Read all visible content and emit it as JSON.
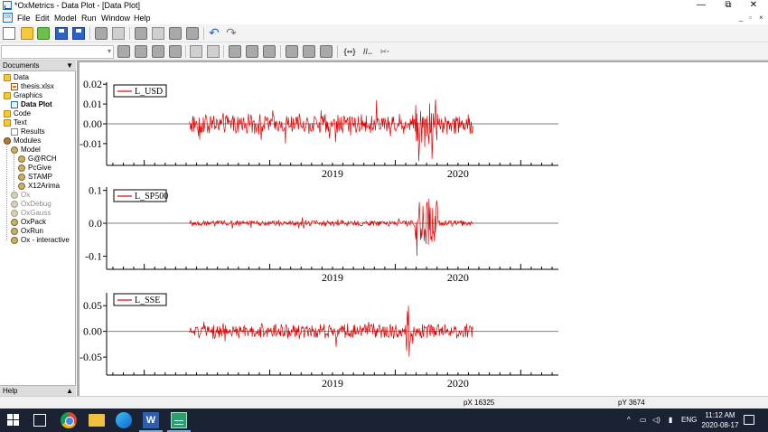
{
  "window": {
    "title": "*OxMetrics - Data Plot - [Data Plot]",
    "minimize_glyph": "—",
    "maximize_glyph": "⧉",
    "close_glyph": "✕"
  },
  "menu": {
    "items": [
      "File",
      "Edit",
      "Model",
      "Run",
      "Window",
      "Help"
    ],
    "mdi_controls": [
      "_",
      "▫",
      "×"
    ]
  },
  "toolbar": {
    "icons": [
      "new-document-icon",
      "open-folder-icon",
      "open-database-icon",
      "save-icon",
      "save-all-icon",
      "print-icon",
      "print-preview-icon",
      "cut-icon",
      "copy-icon",
      "paste-icon",
      "clipboard-icon",
      "undo-icon",
      "redo-icon"
    ],
    "icons_row2": [
      "zoom-in-icon",
      "zoom-out-icon",
      "pointer-icon",
      "rectangle-icon",
      "export-icon",
      "import-icon",
      "search-icon",
      "refresh-icon",
      "chart-icon",
      "arrow-icon",
      "curve-icon",
      "curve-alt-icon",
      "bracket-icon",
      "double-slash-icon",
      "scissors-dots-icon"
    ],
    "row2_texts": [
      "{••}",
      "//..",
      "✂·"
    ]
  },
  "sidebar": {
    "documents_header": "Documents",
    "help_header": "Help",
    "collapse_glyph": "▼",
    "expand_glyph": "▲",
    "tree": [
      {
        "label": "Data",
        "level": 0,
        "icon": "folder",
        "style": "normal"
      },
      {
        "label": "thesis.xlsx",
        "level": 1,
        "icon": "xlsx",
        "style": "normal"
      },
      {
        "label": "Graphics",
        "level": 0,
        "icon": "folder",
        "style": "normal"
      },
      {
        "label": "Data Plot",
        "level": 1,
        "icon": "plot",
        "style": "bold"
      },
      {
        "label": "Code",
        "level": 0,
        "icon": "folder",
        "style": "normal"
      },
      {
        "label": "Text",
        "level": 0,
        "icon": "folder",
        "style": "normal"
      },
      {
        "label": "Results",
        "level": 1,
        "icon": "results",
        "style": "normal"
      },
      {
        "label": "Modules",
        "level": 0,
        "icon": "modules",
        "style": "normal"
      },
      {
        "label": "Model",
        "level": 1,
        "icon": "gear",
        "style": "normal"
      },
      {
        "label": "G@RCH",
        "level": 2,
        "icon": "gear",
        "style": "normal"
      },
      {
        "label": "PcGive",
        "level": 2,
        "icon": "gear",
        "style": "normal"
      },
      {
        "label": "STAMP",
        "level": 2,
        "icon": "gear",
        "style": "normal"
      },
      {
        "label": "X12Arima",
        "level": 2,
        "icon": "gear",
        "style": "normal"
      },
      {
        "label": "Ox",
        "level": 1,
        "icon": "gear-light",
        "style": "gray"
      },
      {
        "label": "OxDebug",
        "level": 1,
        "icon": "gear-light",
        "style": "gray"
      },
      {
        "label": "OxGauss",
        "level": 1,
        "icon": "gear-light",
        "style": "gray"
      },
      {
        "label": "OxPack",
        "level": 1,
        "icon": "gear",
        "style": "normal"
      },
      {
        "label": "OxRun",
        "level": 1,
        "icon": "gear",
        "style": "normal"
      },
      {
        "label": "Ox - interactive",
        "level": 1,
        "icon": "gear",
        "style": "normal"
      }
    ]
  },
  "status": {
    "px": "pX 16325",
    "py": "pY  3674"
  },
  "taskbar": {
    "apps": [
      "windows-start-icon",
      "task-view-icon",
      "chrome-icon",
      "file-explorer-icon",
      "edge-icon",
      "word-icon",
      "oxmetrics-icon"
    ],
    "word_glyph": "W",
    "tray_chevron": "^",
    "tray_icons": [
      "network-icon",
      "speaker-icon",
      "battery-icon"
    ],
    "tray_glyphs": [
      "▭",
      "◁)",
      "▮"
    ],
    "language": "ENG",
    "time": "11:12 AM",
    "date": "2020-08-17"
  },
  "colors": {
    "series_line": "#e00000",
    "zero_line": "#7f7f7f",
    "mdi_background": "#ababab",
    "taskbar": "#1a2233"
  },
  "chart_data": [
    {
      "type": "line",
      "series": [
        {
          "name": "L_USD"
        }
      ],
      "y_ticks": [
        "0.02",
        "0.01",
        "0.00",
        "-0.01"
      ],
      "y_tick_values": [
        0.02,
        0.01,
        0.0,
        -0.01
      ],
      "ylim": [
        -0.021,
        0.021
      ],
      "x_ticks": [
        "2019",
        "2020"
      ],
      "x_tick_values": [
        2019.0,
        2020.0
      ],
      "xlim": [
        2017.7,
        2021.3
      ],
      "x_range": [
        2018.36,
        2020.62
      ],
      "base_amplitude": 0.0045,
      "shock": {
        "start": 2020.16,
        "end": 2020.34,
        "amplitude": 0.011
      }
    },
    {
      "type": "line",
      "series": [
        {
          "name": "L_SP500"
        }
      ],
      "y_ticks": [
        "0.1",
        "0.0",
        "-0.1"
      ],
      "y_tick_values": [
        0.1,
        0.0,
        -0.1
      ],
      "ylim": [
        -0.14,
        0.11
      ],
      "x_ticks": [
        "2019",
        "2020"
      ],
      "x_tick_values": [
        2019.0,
        2020.0
      ],
      "xlim": [
        2017.7,
        2021.3
      ],
      "x_range": [
        2018.36,
        2020.62
      ],
      "base_amplitude": 0.008,
      "shock": {
        "start": 2020.15,
        "end": 2020.34,
        "amplitude": 0.07
      }
    },
    {
      "type": "line",
      "series": [
        {
          "name": "L_SSE"
        }
      ],
      "y_ticks": [
        "0.05",
        "0.00",
        "-0.05"
      ],
      "y_tick_values": [
        0.05,
        0.0,
        -0.05
      ],
      "ylim": [
        -0.085,
        0.075
      ],
      "x_ticks": [
        "2019",
        "2020"
      ],
      "x_tick_values": [
        2019.0,
        2020.0
      ],
      "xlim": [
        2017.7,
        2021.3
      ],
      "x_range": [
        2018.36,
        2020.62
      ],
      "base_amplitude": 0.013,
      "shock": {
        "start": 2020.08,
        "end": 2020.12,
        "amplitude": 0.05
      }
    }
  ]
}
